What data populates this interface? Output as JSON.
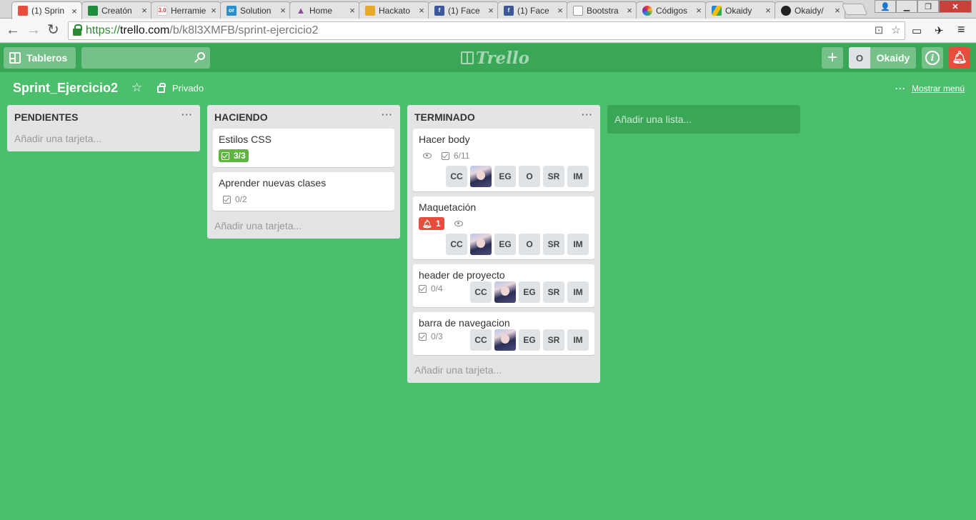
{
  "browser": {
    "tabs": [
      {
        "title": "(1) Sprin",
        "favicon": "trello-icon",
        "color": "#e74c3c",
        "glyph": ""
      },
      {
        "title": "Creatón",
        "favicon": "sheets-icon",
        "color": "#1e8e3e",
        "glyph": ""
      },
      {
        "title": "Herramie",
        "favicon": "number-icon",
        "color": "#ffffff",
        "glyph": "3.0"
      },
      {
        "title": "Solution",
        "favicon": "solution-icon",
        "color": "#2a8fce",
        "glyph": "or"
      },
      {
        "title": "Home",
        "favicon": "triangle-icon",
        "color": "#8a4d9a",
        "glyph": ""
      },
      {
        "title": "Hackato",
        "favicon": "mail-icon",
        "color": "#e6a92b",
        "glyph": ""
      },
      {
        "title": "(1) Face",
        "favicon": "facebook-icon",
        "color": "#3b5998",
        "glyph": "f"
      },
      {
        "title": "(1) Face",
        "favicon": "facebook-icon",
        "color": "#3b5998",
        "glyph": "f"
      },
      {
        "title": "Bootstra",
        "favicon": "page-icon",
        "color": "#dddddd",
        "glyph": ""
      },
      {
        "title": "Códigos",
        "favicon": "color-wheel-icon",
        "color": "#e0a020",
        "glyph": ""
      },
      {
        "title": "Okaidy",
        "favicon": "drive-icon",
        "color": "#fbbc05",
        "glyph": ""
      },
      {
        "title": "Okaidy/",
        "favicon": "github-icon",
        "color": "#222222",
        "glyph": ""
      }
    ],
    "url": {
      "scheme": "https://",
      "host": "trello.com",
      "path": "/b/k8l3XMFB/sprint-ejercicio2"
    }
  },
  "header": {
    "boards_label": "Tableros",
    "logo_text": "Trello",
    "member_initial": "O",
    "member_name": "Okaidy"
  },
  "board": {
    "title": "Sprint_Ejercicio2",
    "privacy": "Privado",
    "show_menu": "Mostrar menú",
    "add_list": "Añadir una lista..."
  },
  "lists": [
    {
      "title": "PENDIENTES",
      "add_card": "Añadir una tarjeta..."
    },
    {
      "title": "HACIENDO",
      "add_card": "Añadir una tarjeta..."
    },
    {
      "title": "TERMINADO",
      "add_card": "Añadir una tarjeta..."
    }
  ],
  "cards": {
    "estilos": {
      "title": "Estilos CSS",
      "checklist": "3/3"
    },
    "aprender": {
      "title": "Aprender nuevas clases",
      "checklist": "0/2"
    },
    "hacer_body": {
      "title": "Hacer body",
      "checklist": "6/11",
      "members": [
        "CC",
        "",
        "EG",
        "O",
        "SR",
        "IM"
      ]
    },
    "maquetacion": {
      "title": "Maquetación",
      "notifications": "1",
      "members": [
        "CC",
        "",
        "EG",
        "O",
        "SR",
        "IM"
      ]
    },
    "header_proyecto": {
      "title": "header de proyecto",
      "checklist": "0/4",
      "members": [
        "CC",
        "",
        "EG",
        "SR",
        "IM"
      ]
    },
    "barra": {
      "title": "barra de navegacion",
      "checklist": "0/3",
      "members": [
        "CC",
        "",
        "EG",
        "SR",
        "IM"
      ]
    }
  },
  "colors": {
    "board_bg": "#4bbf6b",
    "header_bg": "#3aa757",
    "complete_badge": "#5fb53f",
    "alert": "#e74c3c"
  }
}
